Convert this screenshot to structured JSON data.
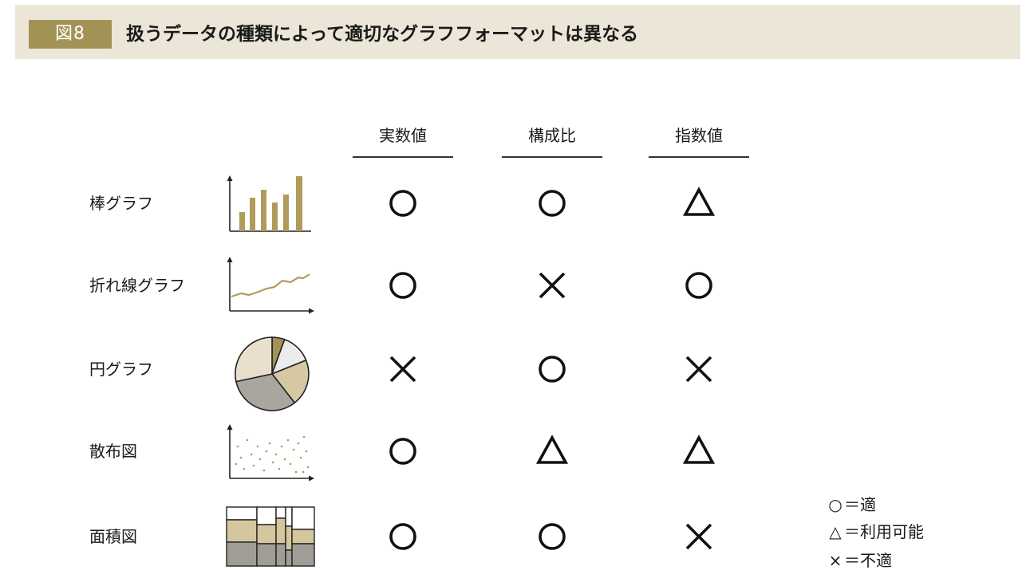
{
  "header": {
    "figure_label": "図8",
    "title": "扱うデータの種類によって適切なグラフフォーマットは異なる"
  },
  "columns": [
    "実数値",
    "構成比",
    "指数値"
  ],
  "rows": [
    {
      "label": "棒グラフ",
      "thumbnail": "bar-chart-icon",
      "marks": [
        "circle",
        "circle",
        "triangle"
      ]
    },
    {
      "label": "折れ線グラフ",
      "thumbnail": "line-chart-icon",
      "marks": [
        "circle",
        "cross",
        "circle"
      ]
    },
    {
      "label": "円グラフ",
      "thumbnail": "pie-chart-icon",
      "marks": [
        "cross",
        "circle",
        "cross"
      ]
    },
    {
      "label": "散布図",
      "thumbnail": "scatter-chart-icon",
      "marks": [
        "circle",
        "triangle",
        "triangle"
      ]
    },
    {
      "label": "面積図",
      "thumbnail": "area-chart-icon",
      "marks": [
        "circle",
        "circle",
        "cross"
      ]
    }
  ],
  "legend": [
    {
      "symbol": "○",
      "text": "＝適"
    },
    {
      "symbol": "△",
      "text": "＝利用可能"
    },
    {
      "symbol": "×",
      "text": "＝不適"
    }
  ],
  "colors": {
    "title_bar_bg": "#ebe6d7",
    "badge_bg": "#a39256",
    "accent_gold": "#b09a5c",
    "light_beige": "#e7ddc1",
    "mid_beige": "#d4c69d",
    "gray": "#a9a6a0",
    "dark_gray": "#8f8c86"
  }
}
